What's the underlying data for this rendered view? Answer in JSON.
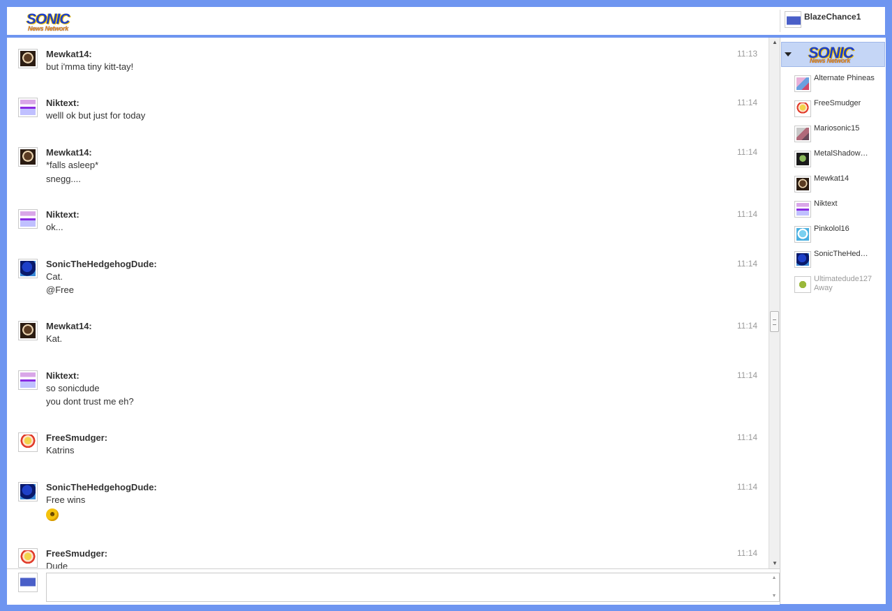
{
  "header": {
    "logo_line1": "SONIC",
    "logo_line2": "News Network",
    "current_user": "BlazeChance1"
  },
  "messages": [
    {
      "sender": "Mewkat14:",
      "lines": [
        "but i'mma tiny kitt-tay!"
      ],
      "time": "11:13",
      "avatar_icon": "mewkat-avatar"
    },
    {
      "sender": "Niktext:",
      "lines": [
        "welll ok but just for today"
      ],
      "time": "11:14",
      "avatar_icon": "niktext-avatar"
    },
    {
      "sender": "Mewkat14:",
      "lines": [
        "*falls asleep*",
        "snegg...."
      ],
      "time": "11:14",
      "avatar_icon": "mewkat-avatar"
    },
    {
      "sender": "Niktext:",
      "lines": [
        "ok..."
      ],
      "time": "11:14",
      "avatar_icon": "niktext-avatar"
    },
    {
      "sender": "SonicTheHedgehogDude:",
      "lines": [
        "Cat.",
        "@Free"
      ],
      "time": "11:14",
      "avatar_icon": "sonic-avatar"
    },
    {
      "sender": "Mewkat14:",
      "lines": [
        "Kat."
      ],
      "time": "11:14",
      "avatar_icon": "mewkat-avatar"
    },
    {
      "sender": "Niktext:",
      "lines": [
        "so sonicdude",
        "you dont trust me eh?"
      ],
      "time": "11:14",
      "avatar_icon": "niktext-avatar"
    },
    {
      "sender": "FreeSmudger:",
      "lines": [
        "Katrins"
      ],
      "time": "11:14",
      "avatar_icon": "freesmudger-avatar"
    },
    {
      "sender": "SonicTheHedgehogDude:",
      "lines": [
        "Free wins"
      ],
      "emoji": "tongue-emoji",
      "time": "11:14",
      "avatar_icon": "sonic-avatar"
    },
    {
      "sender": "FreeSmudger:",
      "lines": [
        "Dude"
      ],
      "time": "11:14",
      "avatar_icon": "freesmudger-avatar"
    }
  ],
  "input": {
    "value": "",
    "placeholder": ""
  },
  "userlist": {
    "room_logo_line1": "SONIC",
    "room_logo_line2": "News Network",
    "users": [
      {
        "name": "Alternate Phineas",
        "status": ""
      },
      {
        "name": "FreeSmudger",
        "status": ""
      },
      {
        "name": "Mariosonic15",
        "status": ""
      },
      {
        "name": "MetalShadow…",
        "status": ""
      },
      {
        "name": "Mewkat14",
        "status": ""
      },
      {
        "name": "Niktext",
        "status": ""
      },
      {
        "name": "Pinkolol16",
        "status": ""
      },
      {
        "name": "SonicTheHed…",
        "status": ""
      },
      {
        "name": "Ultimatedude127",
        "status": "Away"
      }
    ]
  },
  "colors": {
    "frame_blue": "#6e95f0",
    "room_header": "#c5d6f6",
    "text": "#333333",
    "timestamp": "#999999",
    "away": "#9a9a9a"
  }
}
